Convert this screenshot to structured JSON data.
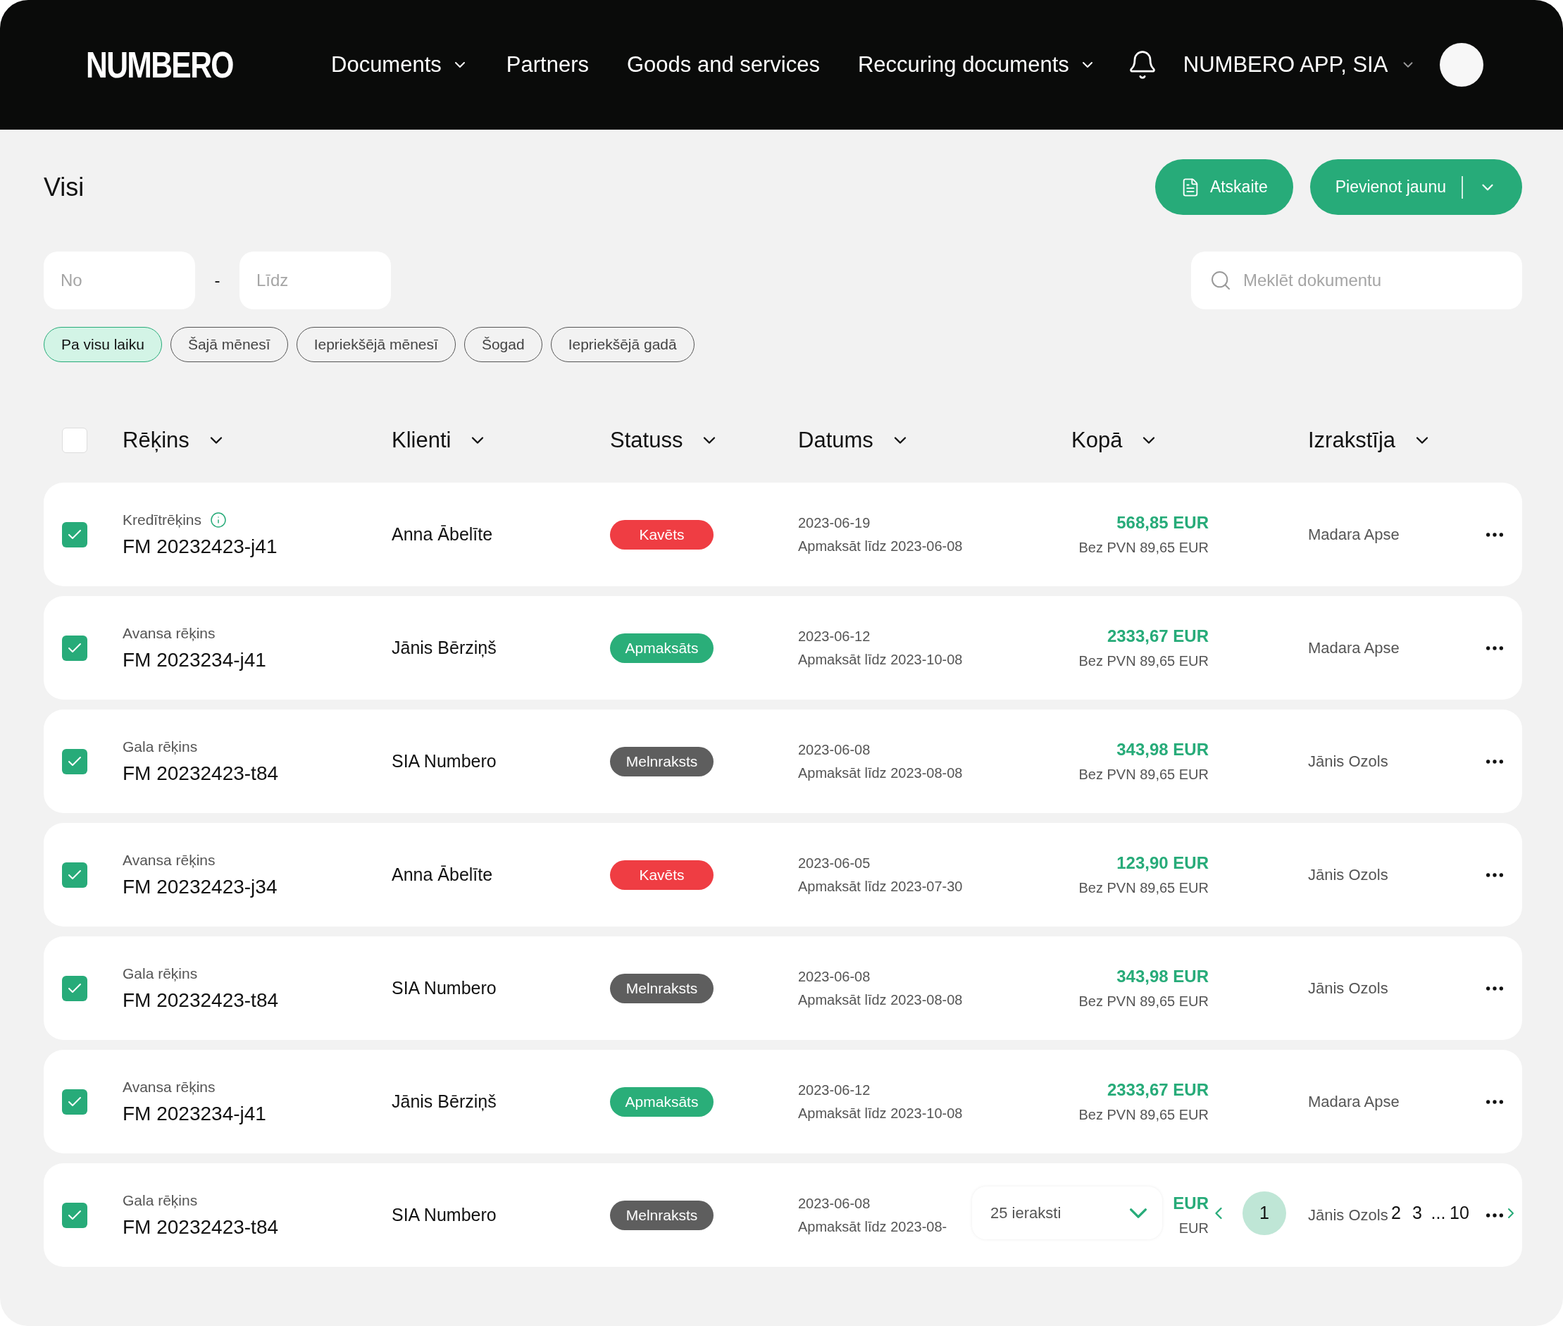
{
  "header": {
    "logo": "NUMBERO",
    "nav": [
      {
        "label": "Documents",
        "dropdown": true
      },
      {
        "label": "Partners",
        "dropdown": false
      },
      {
        "label": "Goods and services",
        "dropdown": false
      },
      {
        "label": "Reccuring documents",
        "dropdown": true
      }
    ],
    "company": "NUMBERO APP, SIA"
  },
  "page": {
    "title": "Visi",
    "buttons": [
      {
        "label": "Atskaite",
        "kind": "report"
      },
      {
        "label": "Pievienot jaunu",
        "kind": "split"
      }
    ]
  },
  "filters": {
    "from": {
      "placeholder": "No"
    },
    "separator": "-",
    "to": {
      "placeholder": "Līdz"
    },
    "search": {
      "placeholder": "Meklēt dokumentu"
    },
    "chips": [
      {
        "label": "Pa visu laiku",
        "selected": true
      },
      {
        "label": "Šajā mēnesī",
        "selected": false
      },
      {
        "label": "Iepriekšējā mēnesī",
        "selected": false
      },
      {
        "label": "Šogad",
        "selected": false
      },
      {
        "label": "Iepriekšējā gadā",
        "selected": false
      }
    ]
  },
  "table": {
    "all_checked": false,
    "columns": [
      "Rēķins",
      "Klienti",
      "Statuss",
      "Datums",
      "Kopā",
      "Izrakstīja"
    ],
    "rows": [
      {
        "checked": true,
        "type": "Kredītrēķins",
        "info": true,
        "number": "FM 20232423-j41",
        "client": "Anna Ābelīte",
        "status": {
          "label": "Kavēts",
          "color": "#ef3d43"
        },
        "date": "2023-06-19",
        "due": "Apmaksāt līdz 2023-06-08",
        "total": "568,85 EUR",
        "net": "Bez PVN 89,65 EUR",
        "issuer": "Madara Apse"
      },
      {
        "checked": true,
        "type": "Avansa rēķins",
        "info": false,
        "number": "FM 2023234-j41",
        "client": "Jānis Bērziņš",
        "status": {
          "label": "Apmaksāts",
          "color": "#2aae79"
        },
        "date": "2023-06-12",
        "due": "Apmaksāt līdz 2023-10-08",
        "total": "2333,67 EUR",
        "net": "Bez PVN 89,65 EUR",
        "issuer": "Madara Apse"
      },
      {
        "checked": true,
        "type": "Gala rēķins",
        "info": false,
        "number": "FM 20232423-t84",
        "client": "SIA Numbero",
        "status": {
          "label": "Melnraksts",
          "color": "#5e5e5e"
        },
        "date": "2023-06-08",
        "due": "Apmaksāt līdz 2023-08-08",
        "total": "343,98 EUR",
        "net": "Bez PVN 89,65 EUR",
        "issuer": "Jānis Ozols"
      },
      {
        "checked": true,
        "type": "Avansa rēķins",
        "info": false,
        "number": "FM 20232423-j34",
        "client": "Anna Ābelīte",
        "status": {
          "label": "Kavēts",
          "color": "#ef3d43"
        },
        "date": "2023-06-05",
        "due": "Apmaksāt līdz 2023-07-30",
        "total": "123,90 EUR",
        "net": "Bez PVN 89,65 EUR",
        "issuer": "Jānis Ozols"
      },
      {
        "checked": true,
        "type": "Gala rēķins",
        "info": false,
        "number": "FM 20232423-t84",
        "client": "SIA Numbero",
        "status": {
          "label": "Melnraksts",
          "color": "#5e5e5e"
        },
        "date": "2023-06-08",
        "due": "Apmaksāt līdz 2023-08-08",
        "total": "343,98 EUR",
        "net": "Bez PVN 89,65 EUR",
        "issuer": "Jānis Ozols"
      },
      {
        "checked": true,
        "type": "Avansa rēķins",
        "info": false,
        "number": "FM 2023234-j41",
        "client": "Jānis Bērziņš",
        "status": {
          "label": "Apmaksāts",
          "color": "#2aae79"
        },
        "date": "2023-06-12",
        "due": "Apmaksāt līdz 2023-10-08",
        "total": "2333,67 EUR",
        "net": "Bez PVN 89,65 EUR",
        "issuer": "Madara Apse"
      },
      {
        "checked": true,
        "type": "Gala rēķins",
        "info": false,
        "number": "FM 20232423-t84",
        "client": "SIA Numbero",
        "status": {
          "label": "Melnraksts",
          "color": "#5e5e5e"
        },
        "date": "2023-06-08",
        "due": "Apmaksāt līdz 2023-08-",
        "total": "EUR",
        "net": "EUR",
        "issuer": "Jānis Ozols"
      }
    ]
  },
  "pagination": {
    "page_size": "25 ieraksti",
    "pages": [
      {
        "label": "1",
        "selected": true
      },
      {
        "label": "2",
        "selected": false
      },
      {
        "label": "3",
        "selected": false
      },
      {
        "label": "...",
        "selected": false
      },
      {
        "label": "10",
        "selected": false
      }
    ]
  }
}
